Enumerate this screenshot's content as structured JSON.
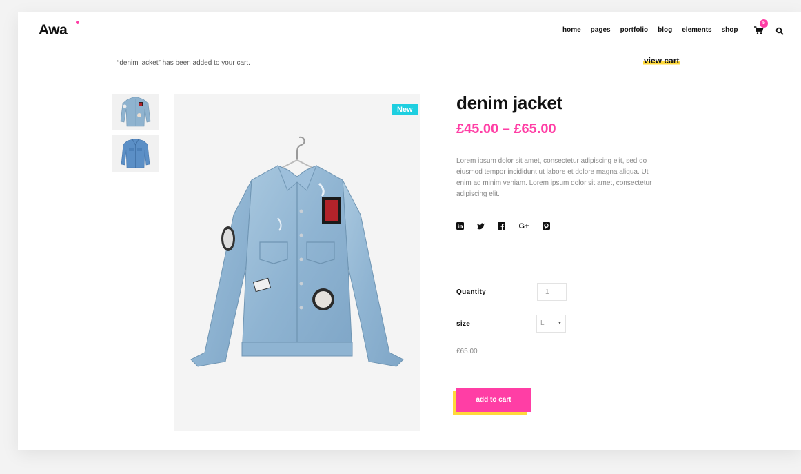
{
  "header": {
    "logo": "Awa",
    "nav": [
      "home",
      "pages",
      "portfolio",
      "blog",
      "elements",
      "shop"
    ],
    "cart_count": "5"
  },
  "notice": {
    "text": "“denim jacket” has been added to your cart.",
    "view_cart_label": "view cart"
  },
  "product": {
    "badge": "New",
    "title": "denim jacket",
    "price_range": "£45.00 – £65.00",
    "description": "Lorem ipsum dolor sit amet, consectetur adipiscing elit, sed do eiusmod tempor incididunt ut labore et dolore magna aliqua. Ut enim ad minim veniam. Lorem ipsum dolor sit amet, consectetur adipiscing elit.",
    "socials": [
      "linkedin-icon",
      "twitter-icon",
      "facebook-icon",
      "google-plus-icon",
      "pinterest-icon"
    ],
    "google_plus_text": "G+",
    "quantity_label": "Quantity",
    "quantity_value": "1",
    "size_label": "size",
    "size_value": "L",
    "variation_price": "£65.00",
    "add_to_cart_label": "add to cart"
  },
  "colors": {
    "accent": "#ff3ea5",
    "highlight": "#ffd93b",
    "badge": "#1ecfe0"
  }
}
